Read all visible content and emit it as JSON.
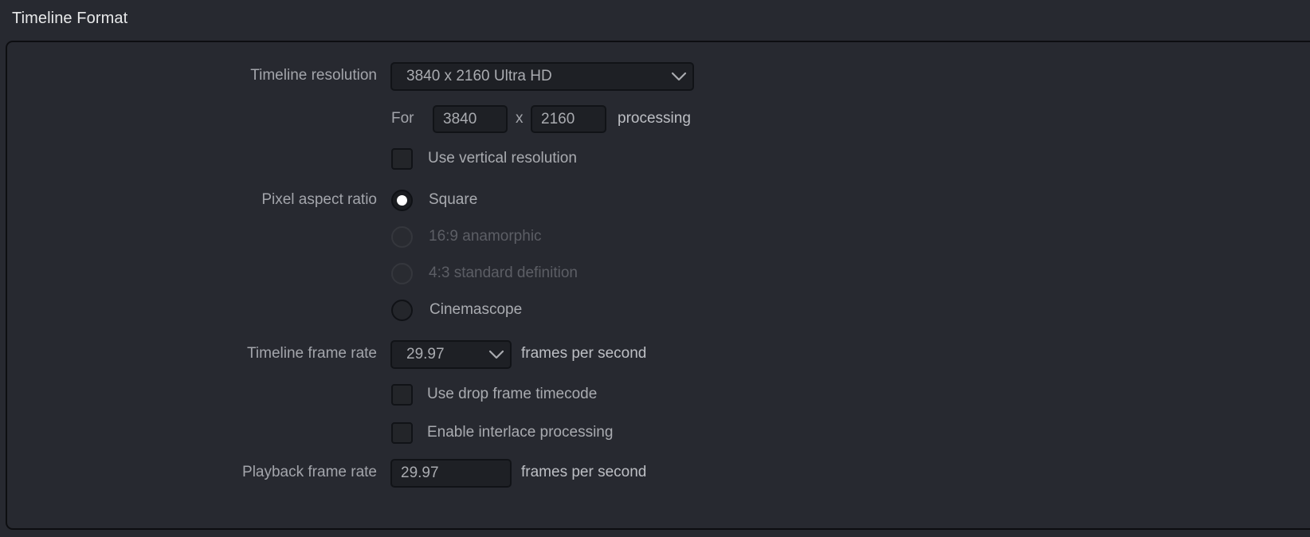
{
  "section": {
    "title": "Timeline Format"
  },
  "fields": {
    "timeline_resolution": {
      "label": "Timeline resolution",
      "value": "3840 x 2160 Ultra HD",
      "chevron_icon": "chevron-down-icon"
    },
    "custom_resolution": {
      "prefix": "For",
      "width_value": "3840",
      "separator": "x",
      "height_value": "2160",
      "suffix": "processing"
    },
    "use_vertical_resolution": {
      "label": "Use vertical resolution",
      "checked": false
    },
    "pixel_aspect_ratio": {
      "label": "Pixel aspect ratio",
      "options": [
        {
          "label": "Square",
          "selected": true,
          "disabled": false
        },
        {
          "label": "16:9 anamorphic",
          "selected": false,
          "disabled": true
        },
        {
          "label": "4:3 standard definition",
          "selected": false,
          "disabled": true
        },
        {
          "label": "Cinemascope",
          "selected": false,
          "disabled": false
        }
      ]
    },
    "timeline_frame_rate": {
      "label": "Timeline frame rate",
      "value": "29.97",
      "units": "frames per second",
      "chevron_icon": "chevron-down-icon"
    },
    "use_drop_frame_timecode": {
      "label": "Use drop frame timecode",
      "checked": false
    },
    "enable_interlace_processing": {
      "label": "Enable interlace processing",
      "checked": false
    },
    "playback_frame_rate": {
      "label": "Playback frame rate",
      "value": "29.97",
      "units": "frames per second"
    }
  },
  "colors": {
    "background": "#272930",
    "control_fill": "#1e2025",
    "border": "#111317",
    "text": "#a9abb0",
    "heading": "#e8e9ea",
    "disabled_text": "#5c5e65"
  }
}
